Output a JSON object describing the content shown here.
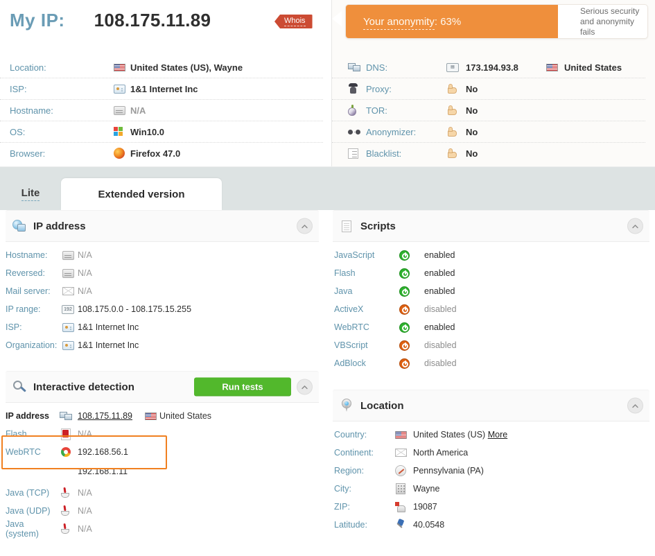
{
  "header": {
    "my_ip_label": "My IP:",
    "my_ip_value": "108.175.11.89",
    "whois_label": "Whois",
    "rows": [
      {
        "label": "Location:",
        "value": "United States (US), Wayne",
        "icon": "us-flag-icon",
        "na": false
      },
      {
        "label": "ISP:",
        "value": "1&1 Internet Inc",
        "icon": "isp-icon",
        "na": false
      },
      {
        "label": "Hostname:",
        "value": "N/A",
        "icon": "server-icon",
        "na": true
      },
      {
        "label": "OS:",
        "value": "Win10.0",
        "icon": "windows-icon",
        "na": false
      },
      {
        "label": "Browser:",
        "value": "Firefox 47.0",
        "icon": "firefox-icon",
        "na": false
      }
    ]
  },
  "anonymity": {
    "title": "Your anonymity",
    "percent": "63%",
    "separator": ": ",
    "note": "Serious security and anonymity fails",
    "bar_color": "#ef8f3c",
    "rows": [
      {
        "label": "DNS:",
        "value": "173.194.93.8",
        "icon": "dns-icon",
        "country": "United States",
        "thumb": false
      },
      {
        "label": "Proxy:",
        "value": "No",
        "icon": "proxy-icon",
        "country": "",
        "thumb": true
      },
      {
        "label": "TOR:",
        "value": "No",
        "icon": "tor-icon",
        "country": "",
        "thumb": true
      },
      {
        "label": "Anonymizer:",
        "value": "No",
        "icon": "anonymizer-icon",
        "country": "",
        "thumb": true
      },
      {
        "label": "Blacklist:",
        "value": "No",
        "icon": "blacklist-icon",
        "country": "",
        "thumb": true
      }
    ]
  },
  "tabs": {
    "lite": "Lite",
    "extended": "Extended version",
    "active": "extended"
  },
  "ip_panel": {
    "title": "IP address",
    "rows": [
      {
        "label": "Hostname:",
        "value": "N/A",
        "icon": "server-icon",
        "na": true
      },
      {
        "label": "Reversed:",
        "value": "N/A",
        "icon": "server-icon",
        "na": true
      },
      {
        "label": "Mail server:",
        "value": "N/A",
        "icon": "mail-icon",
        "na": true
      },
      {
        "label": "IP range:",
        "value": "108.175.0.0 - 108.175.15.255",
        "icon": "iprange-icon",
        "na": false
      },
      {
        "label": "ISP:",
        "value": "1&1 Internet Inc",
        "icon": "isp-icon",
        "na": false
      },
      {
        "label": "Organization:",
        "value": "1&1 Internet Inc",
        "icon": "id-card-icon",
        "na": false
      }
    ]
  },
  "interactive": {
    "title": "Interactive detection",
    "run_tests_label": "Run tests",
    "run_tests_color": "#52b82c",
    "highlight_color": "#f08020",
    "rows": [
      {
        "label": "IP address",
        "value": "108.175.11.89",
        "icon": "network-icon",
        "country": "United States",
        "bold": true,
        "link": true,
        "na": false
      },
      {
        "label": "Flash",
        "value": "N/A",
        "icon": "flash-icon",
        "country": "",
        "bold": false,
        "link": false,
        "na": true
      },
      {
        "label": "WebRTC",
        "value": "192.168.56.1",
        "icon": "chrome-icon",
        "country": "",
        "bold": false,
        "link": false,
        "na": false
      },
      {
        "label": "",
        "value": "192.168.1.11",
        "icon": "",
        "country": "",
        "bold": false,
        "link": false,
        "na": false
      },
      {
        "label": "Java (TCP)",
        "value": "N/A",
        "icon": "java-icon",
        "country": "",
        "bold": false,
        "link": false,
        "na": true
      },
      {
        "label": "Java (UDP)",
        "value": "N/A",
        "icon": "java-icon",
        "country": "",
        "bold": false,
        "link": false,
        "na": true
      },
      {
        "label": "Java (system)",
        "value": "N/A",
        "icon": "java-icon",
        "country": "",
        "bold": false,
        "link": false,
        "na": true
      }
    ]
  },
  "scripts": {
    "title": "Scripts",
    "rows": [
      {
        "label": "JavaScript",
        "value": "enabled",
        "state": "on"
      },
      {
        "label": "Flash",
        "value": "enabled",
        "state": "on"
      },
      {
        "label": "Java",
        "value": "enabled",
        "state": "on"
      },
      {
        "label": "ActiveX",
        "value": "disabled",
        "state": "off"
      },
      {
        "label": "WebRTC",
        "value": "enabled",
        "state": "on"
      },
      {
        "label": "VBScript",
        "value": "disabled",
        "state": "off"
      },
      {
        "label": "AdBlock",
        "value": "disabled",
        "state": "off"
      }
    ]
  },
  "location": {
    "title": "Location",
    "more_label": "More",
    "rows": [
      {
        "label": "Country:",
        "value": "United States (US)",
        "icon": "us-flag-icon",
        "more": true
      },
      {
        "label": "Continent:",
        "value": "North America",
        "icon": "mail-icon",
        "more": false
      },
      {
        "label": "Region:",
        "value": "Pennsylvania (PA)",
        "icon": "compass-icon",
        "more": false
      },
      {
        "label": "City:",
        "value": "Wayne",
        "icon": "city-icon",
        "more": false
      },
      {
        "label": "ZIP:",
        "value": "19087",
        "icon": "mailbox-icon",
        "more": false
      },
      {
        "label": "Latitude:",
        "value": "40.0548",
        "icon": "pushpin-icon",
        "more": false
      }
    ]
  }
}
